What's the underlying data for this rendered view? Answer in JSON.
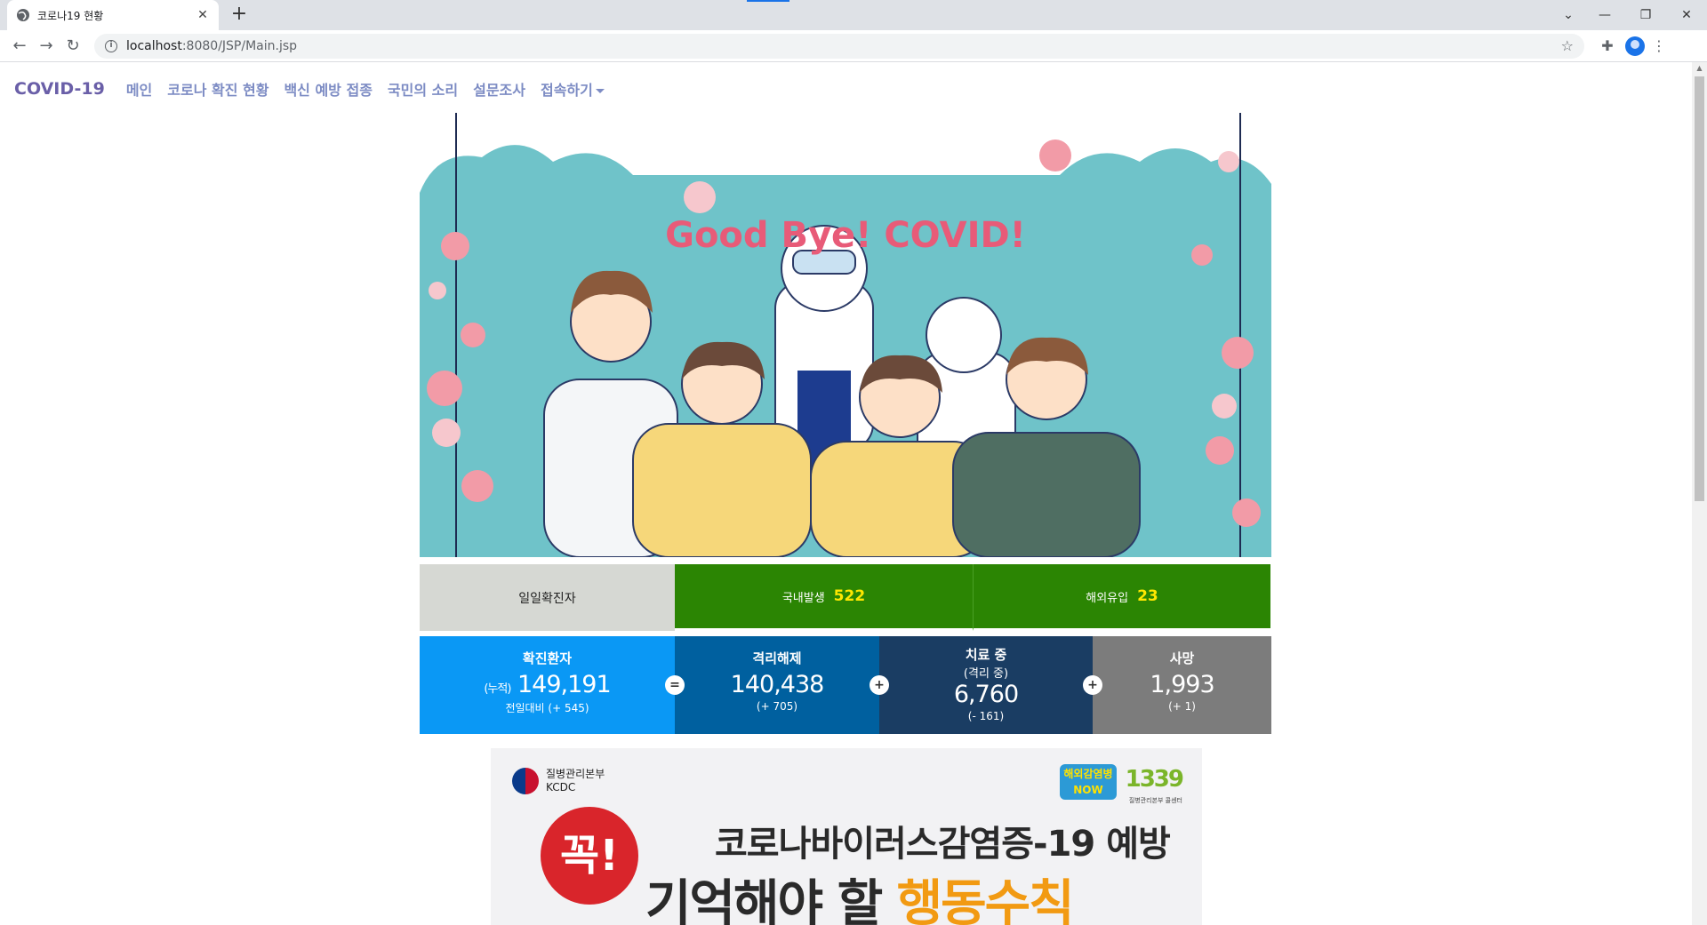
{
  "browser": {
    "tab_title": "코로나19 현황",
    "url_host": "localhost",
    "url_rest": ":8080/JSP/Main.jsp"
  },
  "nav": {
    "brand": "COVID-19",
    "links": [
      "메인",
      "코로나 확진 현황",
      "백신 예방 접종",
      "국민의 소리",
      "설문조사",
      "접속하기"
    ]
  },
  "hero": {
    "title": "Good Bye! COVID!"
  },
  "daily": {
    "label": "일일확진자",
    "domestic_label": "국내발생",
    "domestic_value": "522",
    "overseas_label": "해외유입",
    "overseas_value": "23"
  },
  "stats": {
    "confirmed": {
      "title": "확진환자",
      "prefix": "(누적)",
      "value": "149,191",
      "delta": "전일대비 (+ 545)"
    },
    "released": {
      "title": "격리해제",
      "value": "140,438",
      "delta": "(+ 705)"
    },
    "treating": {
      "title": "치료 중",
      "subtitle": "(격리 중)",
      "value": "6,760",
      "delta": "(- 161)"
    },
    "deaths": {
      "title": "사망",
      "value": "1,993",
      "delta": "(+ 1)"
    },
    "ops": [
      "=",
      "+",
      "+"
    ]
  },
  "banner": {
    "org_name": "질병관리본부",
    "org_abbr": "KCDC",
    "now_line1": "해외감염병",
    "now_line2": "NOW",
    "hotline": "1339",
    "hotline_sub": "질병관리본부 콜센터",
    "stamp": "꼭!",
    "line1": "코로나바이러스감염증-19 예방",
    "line2_a": "기억해야 할 ",
    "line2_b": "행동수칙"
  },
  "colors": {
    "confirmed": "#0a98f5",
    "released": "#00609f",
    "treating": "#1a3d63",
    "deaths": "#7c7c7c",
    "green": "#2b8503",
    "highlight": "#ffe700"
  }
}
